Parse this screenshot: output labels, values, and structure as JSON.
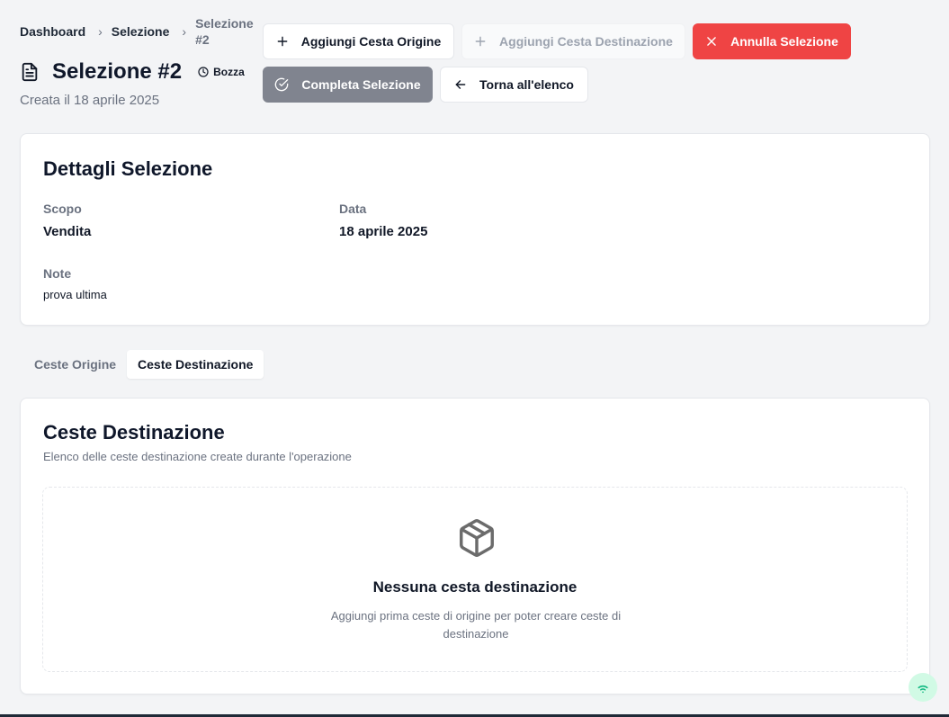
{
  "breadcrumb": {
    "items": [
      "Dashboard",
      "Selezione"
    ],
    "current": "Selezione #2"
  },
  "page": {
    "title": "Selezione #2",
    "status": "Bozza",
    "created": "Creata il 18 aprile 2025"
  },
  "toolbar": {
    "add_origin": "Aggiungi Cesta Origine",
    "add_destination": "Aggiungi Cesta Destinazione",
    "cancel": "Annulla Selezione",
    "complete": "Completa Selezione",
    "back": "Torna all'elenco"
  },
  "details": {
    "title": "Dettagli Selezione",
    "scope_label": "Scopo",
    "scope_value": "Vendita",
    "date_label": "Data",
    "date_value": "18 aprile 2025",
    "note_label": "Note",
    "note_value": "prova ultima"
  },
  "tabs": [
    {
      "label": "Ceste Origine",
      "active": false
    },
    {
      "label": "Ceste Destinazione",
      "active": true
    }
  ],
  "destination": {
    "title": "Ceste Destinazione",
    "description": "Elenco delle ceste destinazione create durante l'operazione",
    "empty_title": "Nessuna cesta destinazione",
    "empty_text": "Aggiungi prima ceste di origine per poter creare ceste di destinazione"
  },
  "colors": {
    "danger": "#ef4444",
    "disabled": "#80848f",
    "online": "#10b981"
  },
  "icons": [
    "file-text-icon",
    "clock-icon",
    "plus-icon",
    "x-icon",
    "check-circle-icon",
    "arrow-left-icon",
    "package-icon",
    "wifi-icon"
  ]
}
